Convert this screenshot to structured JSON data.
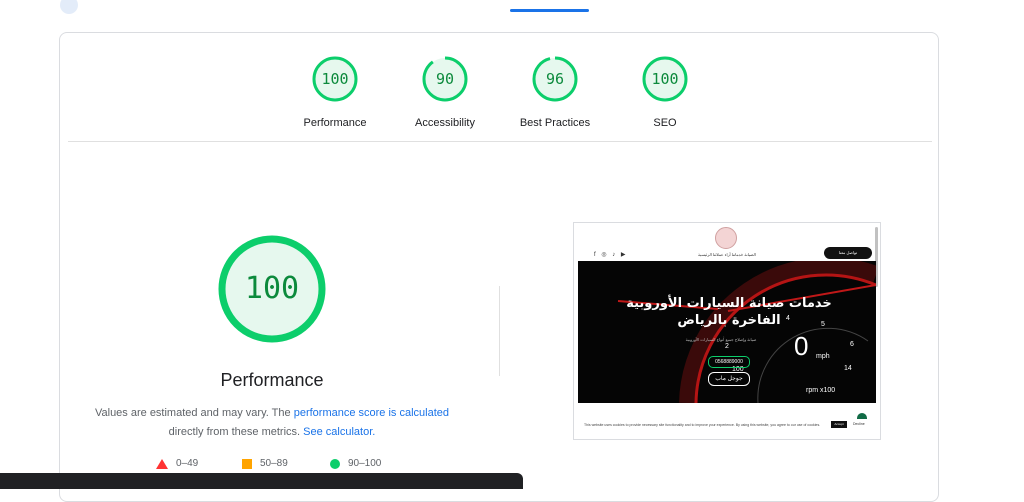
{
  "header": {
    "title": ""
  },
  "categories": [
    {
      "label": "Performance",
      "score": "100"
    },
    {
      "label": "Accessibility",
      "score": "90"
    },
    {
      "label": "Best Practices",
      "score": "96"
    },
    {
      "label": "SEO",
      "score": "100"
    }
  ],
  "colors": {
    "pass": "#0cce6b",
    "pass_text": "#0c8a3c",
    "average": "#ffa400",
    "fail": "#ff3333",
    "link": "#1a73e8"
  },
  "main": {
    "score": "100",
    "score_fraction": 1.0,
    "label": "Performance",
    "note_1": "Values are estimated and may vary. The",
    "note_link_1": "performance score is calculated",
    "note_2": "directly from these metrics.",
    "note_link_2": "See calculator."
  },
  "legend": [
    {
      "icon": "triangle-icon",
      "label": "0–49"
    },
    {
      "icon": "square-icon",
      "label": "50–89"
    },
    {
      "icon": "circle-icon",
      "label": "90–100"
    }
  ],
  "screenshot": {
    "social_icons": "f ◎ ♪ ▶",
    "menu": "الصيانة  خدماتنا  آراء عملائنا  الرئيسية",
    "call_button": "تواصل معنا",
    "hero_title": "خدمات صيانة السيارات الأوروبية الفاخرة بالرياض",
    "hero_sub": "صيانة وإصلاح جميع أنواع السيارات الأوروبية",
    "phone_button": "0568889000",
    "map_button": "جوجل ماب",
    "dial_big": "0",
    "dial_4": "4",
    "dial_2": "2",
    "dial_5": "5",
    "dial_6": "6",
    "dial_100": "100",
    "dial_14": "14",
    "dial_mph": "mph",
    "dial_x100": "rpm x100",
    "cookie_text": "This website uses cookies to provide necessary site functionality and to improve your experience. By using this website, you agree to our use of cookies.",
    "accept_label": "Accept",
    "decline_label": "Decline"
  }
}
